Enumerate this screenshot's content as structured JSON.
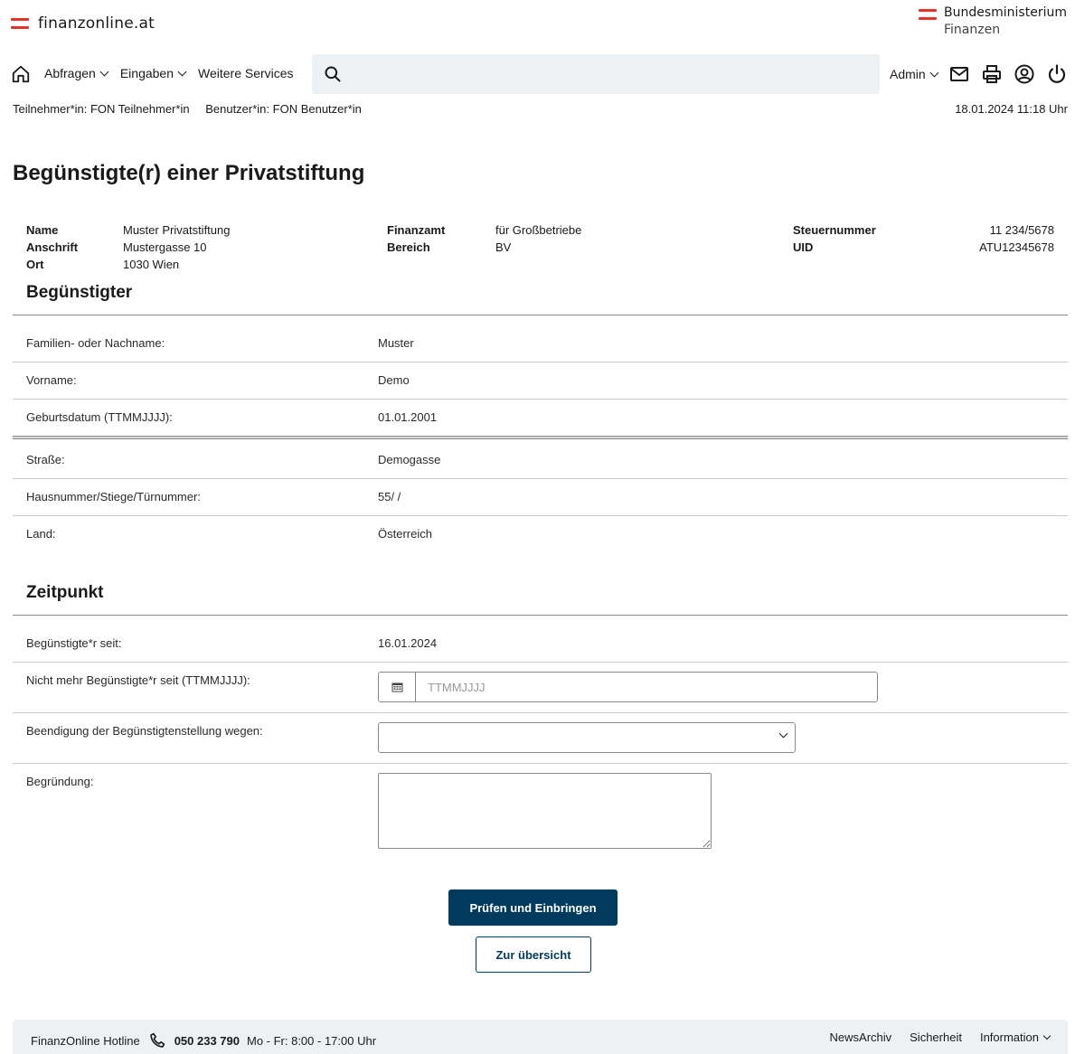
{
  "header": {
    "brand": "finanzonline.at",
    "ministry_line1": "Bundesministerium",
    "ministry_line2": "Finanzen",
    "accent_color": "#e6332a"
  },
  "nav": {
    "items": [
      {
        "label": "Abfragen",
        "has_dropdown": true
      },
      {
        "label": "Eingaben",
        "has_dropdown": true
      },
      {
        "label": "Weitere Services",
        "has_dropdown": false
      }
    ],
    "search_placeholder": "",
    "admin_label": "Admin",
    "icons": [
      "home-icon",
      "search-icon",
      "mail-icon",
      "printer-icon",
      "user-circle-icon",
      "power-icon"
    ]
  },
  "userline": {
    "participant": "Teilnehmer*in: FON Teilnehmer*in",
    "user": "Benutzer*in: FON Benutzer*in",
    "datetime": "18.01.2024 11:18 Uhr"
  },
  "page_title": "Begünstigte(r) einer Privatstiftung",
  "info": {
    "name_label": "Name",
    "name_value": "Muster Privatstiftung",
    "address_label": "Anschrift",
    "address_value": "Mustergasse 10",
    "city_label": "Ort",
    "city_value": "1030 Wien",
    "office_label": "Finanzamt",
    "office_value": "für Großbetriebe",
    "area_label": "Bereich",
    "area_value": "BV",
    "taxno_label": "Steuernummer",
    "taxno_value": "11 234/5678",
    "uid_label": "UID",
    "uid_value": "ATU12345678"
  },
  "beneficiary": {
    "title": "Begünstigter",
    "rows": [
      {
        "label": "Familien- oder Nachname:",
        "value": "Muster"
      },
      {
        "label": "Vorname:",
        "value": "Demo"
      },
      {
        "label": "Geburtsdatum (TTMMJJJJ):",
        "value": "01.01.2001"
      },
      {
        "label": "Straße:",
        "value": "Demogasse"
      },
      {
        "label": "Hausnummer/Stiege/Türnummer:",
        "value": "55/ /"
      },
      {
        "label": "Land:",
        "value": "Österreich"
      }
    ]
  },
  "timepoint": {
    "title": "Zeitpunkt",
    "since_label": "Begünstigte*r seit:",
    "since_value": "16.01.2024",
    "end_label": "Nicht mehr Begünstigte*r seit (TTMMJJJJ):",
    "end_placeholder": "TTMMJJJJ",
    "end_value": "",
    "reason_label": "Beendigung der Begünstigtenstellung wegen:",
    "reason_selected": "",
    "justification_label": "Begründung:",
    "justification_value": ""
  },
  "actions": {
    "submit": "Prüfen und Einbringen",
    "overview": "Zur übersicht",
    "primary_color": "#003a5d"
  },
  "footer": {
    "hotline_label": "FinanzOnline Hotline",
    "hotline_number": "050 233 790",
    "hours": "Mo - Fr: 8:00 - 17:00 Uhr",
    "links": [
      "NewsArchiv",
      "Sicherheit",
      "Information"
    ]
  }
}
